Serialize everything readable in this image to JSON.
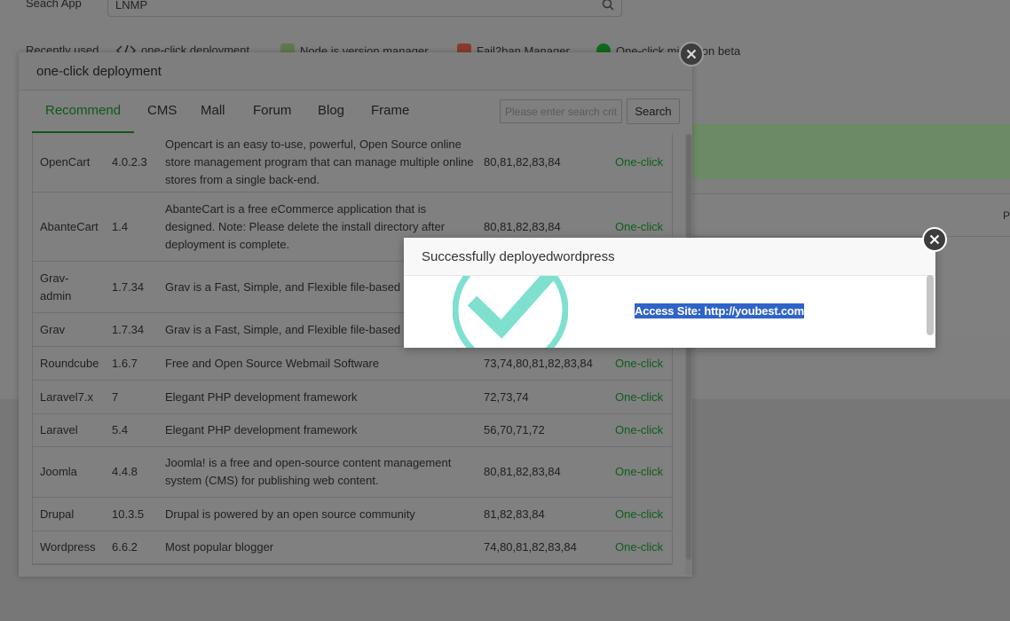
{
  "background": {
    "search_label": "Seach App",
    "search_value": "LNMP",
    "recent_label": "Recently used",
    "recent_items": [
      {
        "label": "one-click deployment",
        "icon": "code-icon"
      },
      {
        "label": "Node.js version manager",
        "icon": "nodejs-icon"
      },
      {
        "label": "Fail2ban Manager",
        "icon": "fail2ban-icon"
      },
      {
        "label": "One-click migration beta",
        "icon": "migration-icon"
      }
    ],
    "panel_text": "P"
  },
  "deploy_dialog": {
    "title": "one-click deployment",
    "tabs": [
      "Recommend",
      "CMS",
      "Mall",
      "Forum",
      "Blog",
      "Frame"
    ],
    "active_tab": "Recommend",
    "search_placeholder": "Please enter search criteria",
    "search_button": "Search",
    "apps": [
      {
        "name": "OpenCart",
        "version": "4.0.2.3",
        "description": "Opencart is an easy to-use, powerful, Open Source online store management program that can manage multiple online stores from a single back-end.",
        "ports": "80,81,82,83,84",
        "action": "One-click"
      },
      {
        "name": "AbanteCart",
        "version": "1.4",
        "description": "AbanteCart is a free eCommerce application that is designed. Note: Please delete the install directory after deployment is complete.",
        "ports": "80,81,82,83,84",
        "action": "One-click"
      },
      {
        "name": "Grav-admin",
        "version": "1.7.34",
        "description": "Grav is a Fast, Simple, and Flexible file-based We",
        "ports": "",
        "action": ""
      },
      {
        "name": "Grav",
        "version": "1.7.34",
        "description": "Grav is a Fast, Simple, and Flexible file-based We",
        "ports": "",
        "action": ""
      },
      {
        "name": "Roundcube",
        "version": "1.6.7",
        "description": "Free and Open Source Webmail Software",
        "ports": "73,74,80,81,82,83,84",
        "action": "One-click"
      },
      {
        "name": "Laravel7.x",
        "version": "7",
        "description": "Elegant PHP development framework",
        "ports": "72,73,74",
        "action": "One-click"
      },
      {
        "name": "Laravel",
        "version": "5.4",
        "description": "Elegant PHP development framework",
        "ports": "56,70,71,72",
        "action": "One-click"
      },
      {
        "name": "Joomla",
        "version": "4.4.8",
        "description": "Joomla! is a free and open-source content management system (CMS) for publishing web content.",
        "ports": "80,81,82,83,84",
        "action": "One-click"
      },
      {
        "name": "Drupal",
        "version": "10.3.5",
        "description": "Drupal is powered by an open source community",
        "ports": "81,82,83,84",
        "action": "One-click"
      },
      {
        "name": "Wordpress",
        "version": "6.6.2",
        "description": "Most popular blogger",
        "ports": "74,80,81,82,83,84",
        "action": "One-click"
      }
    ]
  },
  "success_dialog": {
    "title": "Successfully deployedwordpress",
    "access_text": "Access Site: http://youbest.com",
    "icon": "checkmark-icon"
  },
  "colors": {
    "overlay": "#808080",
    "active_tab": "#0b5a17",
    "one_click": "#0f5c18",
    "check": "#7fe0cf",
    "selection": "#2f63c9"
  }
}
